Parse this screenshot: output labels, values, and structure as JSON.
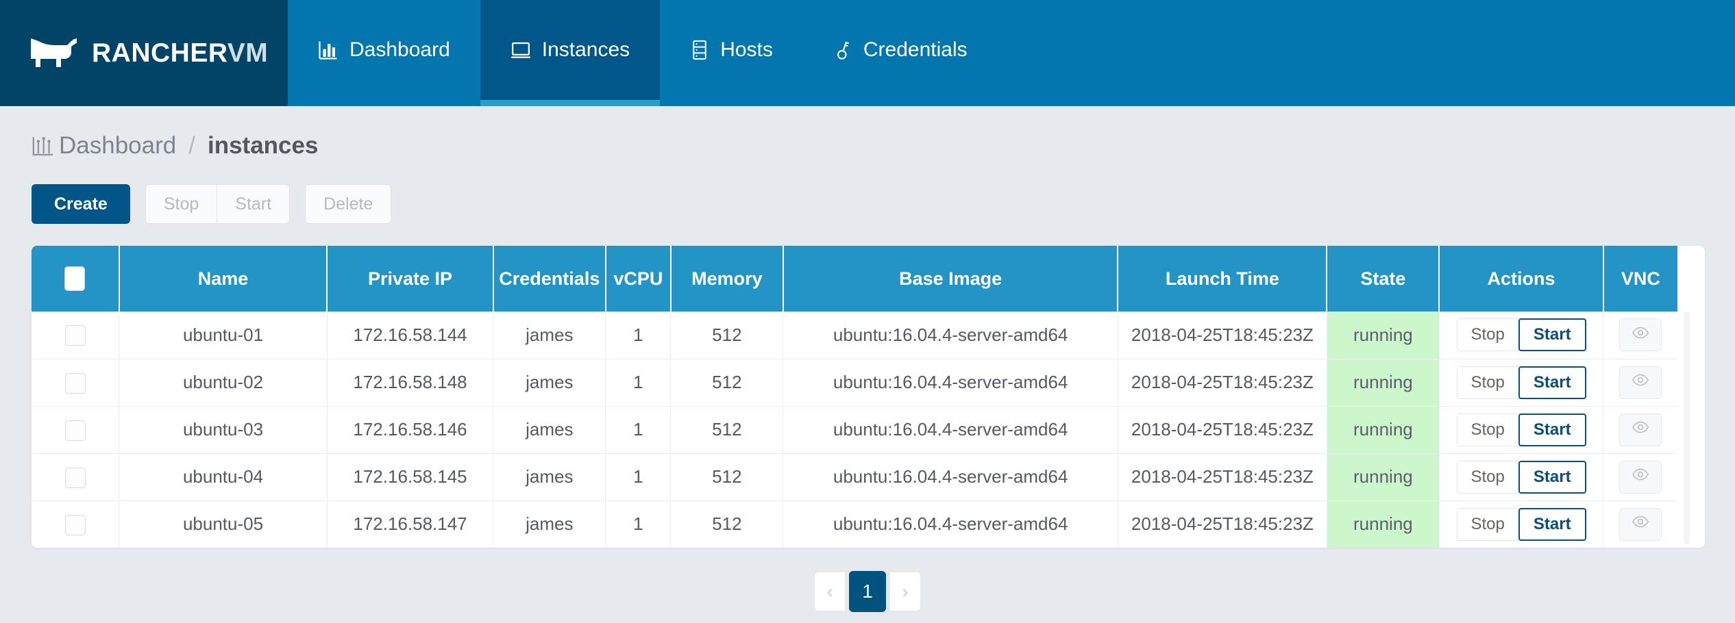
{
  "brand": {
    "name_main": "RANCHER",
    "name_suffix": "VM",
    "logo_icon": "cow-logo-icon"
  },
  "nav": {
    "items": [
      {
        "label": "Dashboard",
        "icon": "bar-chart-icon",
        "active": false
      },
      {
        "label": "Instances",
        "icon": "monitor-icon",
        "active": true
      },
      {
        "label": "Hosts",
        "icon": "server-rack-icon",
        "active": false
      },
      {
        "label": "Credentials",
        "icon": "key-icon",
        "active": false
      }
    ]
  },
  "breadcrumb": {
    "icon": "bar-chart-icon",
    "root": "Dashboard",
    "separator": "/",
    "current": "instances"
  },
  "toolbar": {
    "create_label": "Create",
    "stop_label": "Stop",
    "start_label": "Start",
    "delete_label": "Delete"
  },
  "table": {
    "columns": [
      {
        "key": "select",
        "label": ""
      },
      {
        "key": "name",
        "label": "Name"
      },
      {
        "key": "private_ip",
        "label": "Private IP"
      },
      {
        "key": "credentials",
        "label": "Credentials"
      },
      {
        "key": "vcpu",
        "label": "vCPU"
      },
      {
        "key": "memory",
        "label": "Memory"
      },
      {
        "key": "base_image",
        "label": "Base Image"
      },
      {
        "key": "launch_time",
        "label": "Launch Time"
      },
      {
        "key": "state",
        "label": "State"
      },
      {
        "key": "actions",
        "label": "Actions"
      },
      {
        "key": "vnc",
        "label": "VNC"
      }
    ],
    "row_action_labels": {
      "stop": "Stop",
      "start": "Start",
      "vnc_icon": "eye-icon"
    },
    "rows": [
      {
        "name": "ubuntu-01",
        "private_ip": "172.16.58.144",
        "credentials": "james",
        "vcpu": "1",
        "memory": "512",
        "base_image": "ubuntu:16.04.4-server-amd64",
        "launch_time": "2018-04-25T18:45:23Z",
        "state": "running"
      },
      {
        "name": "ubuntu-02",
        "private_ip": "172.16.58.148",
        "credentials": "james",
        "vcpu": "1",
        "memory": "512",
        "base_image": "ubuntu:16.04.4-server-amd64",
        "launch_time": "2018-04-25T18:45:23Z",
        "state": "running"
      },
      {
        "name": "ubuntu-03",
        "private_ip": "172.16.58.146",
        "credentials": "james",
        "vcpu": "1",
        "memory": "512",
        "base_image": "ubuntu:16.04.4-server-amd64",
        "launch_time": "2018-04-25T18:45:23Z",
        "state": "running"
      },
      {
        "name": "ubuntu-04",
        "private_ip": "172.16.58.145",
        "credentials": "james",
        "vcpu": "1",
        "memory": "512",
        "base_image": "ubuntu:16.04.4-server-amd64",
        "launch_time": "2018-04-25T18:45:23Z",
        "state": "running"
      },
      {
        "name": "ubuntu-05",
        "private_ip": "172.16.58.147",
        "credentials": "james",
        "vcpu": "1",
        "memory": "512",
        "base_image": "ubuntu:16.04.4-server-amd64",
        "launch_time": "2018-04-25T18:45:23Z",
        "state": "running"
      }
    ]
  },
  "pagination": {
    "prev": "‹",
    "current_page": "1",
    "next": "›"
  },
  "colors": {
    "brand_dark": "#014468",
    "nav_blue": "#0377ad",
    "nav_active": "#01578a",
    "nav_active_underline": "#2a9ccd",
    "table_header": "#2494c6",
    "primary_button": "#015588",
    "state_running_bg": "#ccf7cd",
    "page_bg": "#e7eaec",
    "start_button_border": "#0b4d7d"
  }
}
